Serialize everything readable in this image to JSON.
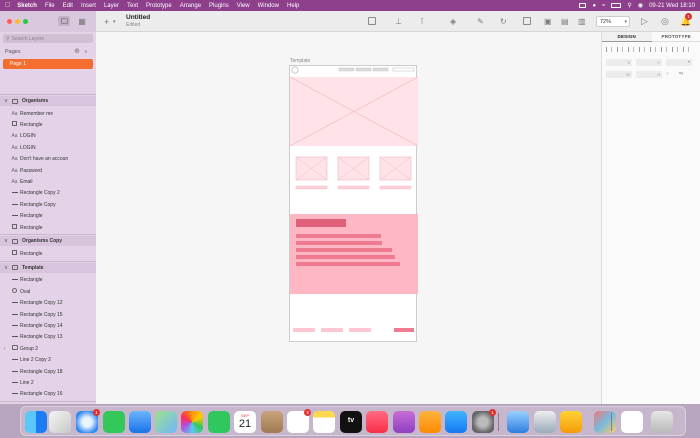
{
  "menubar": {
    "app_name": "Sketch",
    "items": [
      "File",
      "Edit",
      "Insert",
      "Layer",
      "Text",
      "Prototype",
      "Arrange",
      "Plugins",
      "View",
      "Window",
      "Help"
    ],
    "datetime": "09-21 Wed 18:10"
  },
  "toolbar": {
    "doc_title": "Untitled",
    "doc_status": "Edited",
    "zoom_value": "72%",
    "notification_count": "1"
  },
  "sidebar": {
    "search_placeholder": "Search Layers",
    "pages_label": "Pages",
    "pages": [
      {
        "label": "Page 1",
        "selected": true
      }
    ],
    "groups": [
      {
        "name": "Organisms",
        "layers": [
          {
            "label": "Remember me",
            "icon": "text-icon"
          },
          {
            "label": "Rectangle",
            "icon": "rect-icon"
          },
          {
            "label": "LOGIN",
            "icon": "text-icon"
          },
          {
            "label": "LOGIN",
            "icon": "text-icon"
          },
          {
            "label": "Don't have an accoun",
            "icon": "text-icon"
          },
          {
            "label": "Password",
            "icon": "text-icon"
          },
          {
            "label": "Email",
            "icon": "text-icon"
          },
          {
            "label": "Rectangle Copy 2",
            "icon": "line-icon"
          },
          {
            "label": "Rectangle Copy",
            "icon": "line-icon"
          },
          {
            "label": "Rectangle",
            "icon": "line-icon"
          },
          {
            "label": "Rectangle",
            "icon": "rect-icon"
          }
        ]
      },
      {
        "name": "Organisms Copy",
        "layers": [
          {
            "label": "Rectangle",
            "icon": "rect-icon"
          }
        ]
      },
      {
        "name": "Template",
        "layers": [
          {
            "label": "Rectangle",
            "icon": "line-icon"
          },
          {
            "label": "Oval",
            "icon": "oval-icon"
          },
          {
            "label": "Rectangle Copy 12",
            "icon": "line-icon"
          },
          {
            "label": "Rectangle Copy 15",
            "icon": "line-icon"
          },
          {
            "label": "Rectangle Copy 14",
            "icon": "line-icon"
          },
          {
            "label": "Rectangle Copy 13",
            "icon": "line-icon"
          },
          {
            "label": "Group 2",
            "icon": "group-icon",
            "expandable": true
          },
          {
            "label": "Line 2 Copy 2",
            "icon": "line-icon"
          },
          {
            "label": "Rectangle Copy 18",
            "icon": "line-icon"
          },
          {
            "label": "Line 2",
            "icon": "line-icon"
          },
          {
            "label": "Rectangle Copy 16",
            "icon": "line-icon"
          }
        ]
      }
    ]
  },
  "canvas": {
    "artboard_title": "Template"
  },
  "inspector": {
    "tabs": [
      {
        "label": "DESIGN",
        "active": true
      },
      {
        "label": "PROTOTYPE",
        "active": false
      }
    ],
    "field_letters": [
      "X",
      "Y",
      "W",
      "H"
    ]
  },
  "dock": {
    "apps": [
      "finder-icon",
      "launchpad-icon",
      "safari-icon",
      "messages-icon",
      "mail-icon",
      "maps-icon",
      "photos-icon",
      "facetime-icon",
      "calendar-icon",
      "contacts-icon",
      "reminders-icon",
      "notes-icon",
      "tv-icon",
      "music-icon",
      "podcasts-icon",
      "pages-icon",
      "app-store-icon",
      "system-preferences-icon",
      "sketch-file-icon",
      "preview-icon",
      "sketch-icon",
      "screenshot-icon",
      "window-icon",
      "trash-icon"
    ],
    "calendar_month": "SEP",
    "calendar_day": "21",
    "tv_label": "tv",
    "badges": {
      "safari": "1",
      "reminders": "3",
      "system-preferences": "1"
    }
  },
  "colors": {
    "menubar": "#8d3f8b",
    "page_selected": "#f36e2f",
    "wire_pink": "#ffe3e8",
    "wire_strong": "#f8a0b2"
  }
}
